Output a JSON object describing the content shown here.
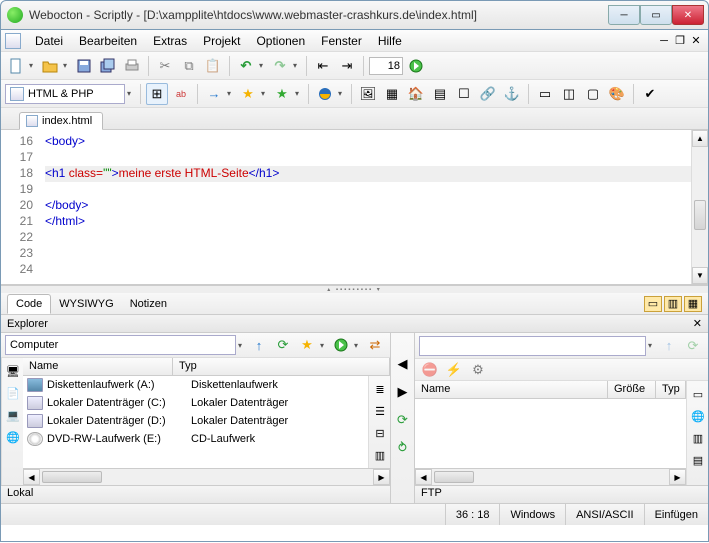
{
  "title": "Webocton - Scriptly - [D:\\xampplite\\htdocs\\www.webmaster-crashkurs.de\\index.html]",
  "menu": {
    "items": [
      "Datei",
      "Bearbeiten",
      "Extras",
      "Projekt",
      "Optionen",
      "Fenster",
      "Hilfe"
    ]
  },
  "toolbar1": {
    "line_spin": "18"
  },
  "toolbar2": {
    "lang": "HTML & PHP"
  },
  "tab": {
    "label": "index.html"
  },
  "code": {
    "first_line": 16,
    "lines": [
      {
        "raw": "<body>",
        "tokens": [
          [
            "tag",
            "<body>"
          ]
        ]
      },
      {
        "raw": "",
        "tokens": []
      },
      {
        "raw": "<h1 class=\"\">meine erste HTML-Seite</h1>",
        "hl": true,
        "tokens": [
          [
            "tag",
            "<h1 "
          ],
          [
            "attr",
            "class="
          ],
          [
            "str",
            "\"\""
          ],
          [
            "tag",
            ">"
          ],
          [
            "txt",
            "meine erste HTML-Seite"
          ],
          [
            "tag",
            "</h1>"
          ]
        ]
      },
      {
        "raw": "",
        "tokens": []
      },
      {
        "raw": "</body>",
        "tokens": [
          [
            "tag",
            "</body>"
          ]
        ]
      },
      {
        "raw": "</html>",
        "tokens": [
          [
            "tag",
            "</html>"
          ]
        ]
      },
      {
        "raw": "",
        "tokens": []
      },
      {
        "raw": "",
        "tokens": []
      },
      {
        "raw": "",
        "tokens": []
      }
    ]
  },
  "subtabs": {
    "items": [
      "Code",
      "WYSIWYG",
      "Notizen"
    ],
    "active": 0
  },
  "explorer": {
    "title": "Explorer",
    "addr": "Computer",
    "cols": {
      "name": "Name",
      "type": "Typ"
    },
    "rows": [
      {
        "icon": "floppy",
        "name": "Diskettenlaufwerk (A:)",
        "type": "Diskettenlaufwerk"
      },
      {
        "icon": "hdd",
        "name": "Lokaler Datenträger (C:)",
        "type": "Lokaler Datenträger"
      },
      {
        "icon": "hdd",
        "name": "Lokaler Datenträger (D:)",
        "type": "Lokaler Datenträger"
      },
      {
        "icon": "cd",
        "name": "DVD-RW-Laufwerk (E:)",
        "type": "CD-Laufwerk"
      }
    ],
    "footer": "Lokal"
  },
  "ftp": {
    "cols": {
      "name": "Name",
      "size": "Größe",
      "type": "Typ"
    },
    "footer": "FTP"
  },
  "status": {
    "pos": "36 : 18",
    "eol": "Windows",
    "enc": "ANSI/ASCII",
    "ins": "Einfügen"
  }
}
